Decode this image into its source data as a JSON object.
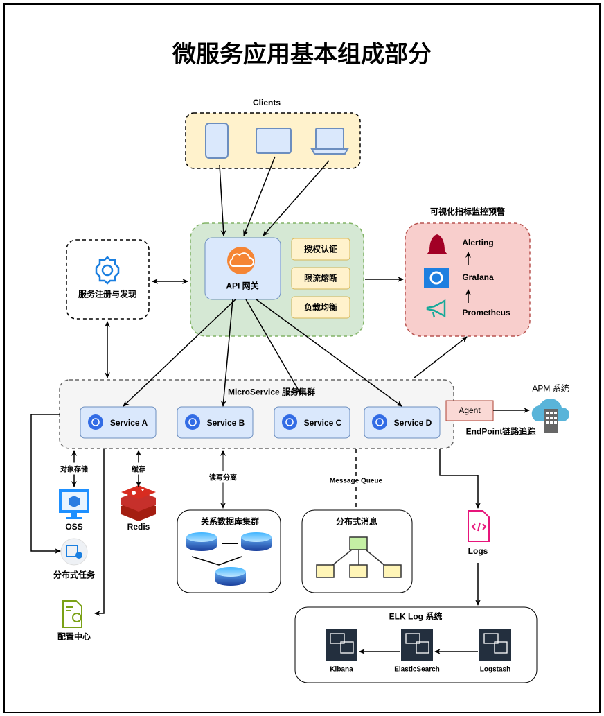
{
  "title": "微服务应用基本组成部分",
  "clients": {
    "label": "Clients",
    "icons": [
      "phone-icon",
      "tablet-icon",
      "laptop-icon"
    ]
  },
  "gateway": {
    "label": "API 网关",
    "features": [
      "授权认证",
      "限流熔断",
      "负载均衡"
    ]
  },
  "registry": {
    "label": "服务注册与发现"
  },
  "monitoring": {
    "label": "可视化指标监控预警",
    "items": [
      "Alerting",
      "Grafana",
      "Prometheus"
    ]
  },
  "cluster": {
    "label": "MicroService 服务集群",
    "services": [
      "Service A",
      "Service B",
      "Service C",
      "Service D"
    ]
  },
  "apm": {
    "agent": "Agent",
    "label": "APM 系统",
    "tracing": "EndPoint链路追踪"
  },
  "storage": {
    "oss_edge": "对象存储",
    "oss": "OSS",
    "cache_edge": "缓存",
    "redis": "Redis",
    "tasks": "分布式任务",
    "config": "配置中心",
    "db_edge": "读写分离",
    "db": "关系数据库集群",
    "mq_edge": "Message Queue",
    "mq": "分布式消息",
    "logs": "Logs"
  },
  "elk": {
    "label": "ELK Log 系统",
    "items": [
      "Kibana",
      "ElasticSearch",
      "Logstash"
    ]
  },
  "colors": {
    "clients": "#fff2cc",
    "gateway": "#d5e8d4",
    "api": "#dae8fc",
    "monitor": "#f8cecc",
    "cluster": "#f5f5f5",
    "agent": "#fad9d5"
  }
}
